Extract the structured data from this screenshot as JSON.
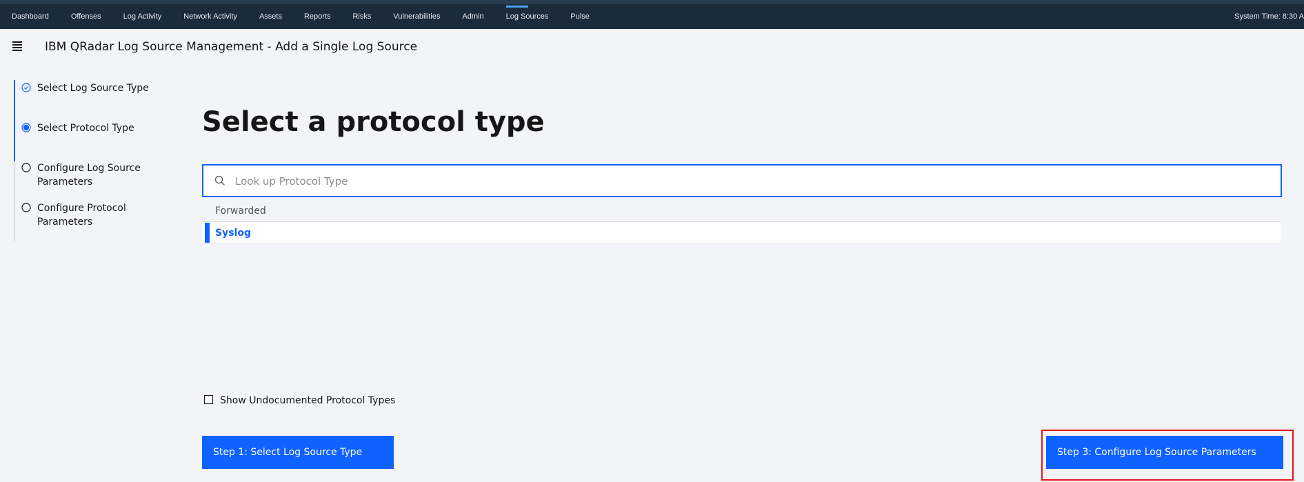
{
  "topnav": {
    "items": [
      {
        "label": "Dashboard",
        "active": false
      },
      {
        "label": "Offenses",
        "active": false
      },
      {
        "label": "Log Activity",
        "active": false
      },
      {
        "label": "Network Activity",
        "active": false
      },
      {
        "label": "Assets",
        "active": false
      },
      {
        "label": "Reports",
        "active": false
      },
      {
        "label": "Risks",
        "active": false
      },
      {
        "label": "Vulnerabilities",
        "active": false
      },
      {
        "label": "Admin",
        "active": false
      },
      {
        "label": "Log Sources",
        "active": true
      },
      {
        "label": "Pulse",
        "active": false
      }
    ],
    "system_time": "System Time: 8:30 A"
  },
  "header": {
    "menu_icon": "hamburger-menu-icon",
    "title": "IBM QRadar Log Source Management - Add a Single Log Source"
  },
  "steps": {
    "items": [
      {
        "label": "Select Log Source Type",
        "state": "complete"
      },
      {
        "label": "Select Protocol Type",
        "state": "current"
      },
      {
        "label": "Configure Log Source Parameters",
        "state": "incomplete"
      },
      {
        "label": "Configure Protocol Parameters",
        "state": "incomplete"
      }
    ]
  },
  "main": {
    "heading": "Select a protocol type",
    "search": {
      "placeholder": "Look up Protocol Type",
      "value": ""
    },
    "protocols": [
      {
        "label": "Forwarded",
        "selected": false
      },
      {
        "label": "Syslog",
        "selected": true
      }
    ],
    "show_undocumented": {
      "label": "Show Undocumented Protocol Types",
      "checked": false
    }
  },
  "footer": {
    "prev_label": "Step 1: Select Log Source Type",
    "next_label": "Step 3: Configure Log Source Parameters"
  },
  "colors": {
    "topbar": "#1c2b3a",
    "accent": "#0f62fe",
    "highlight_box": "#e8141c",
    "background": "#f2f4f8"
  }
}
